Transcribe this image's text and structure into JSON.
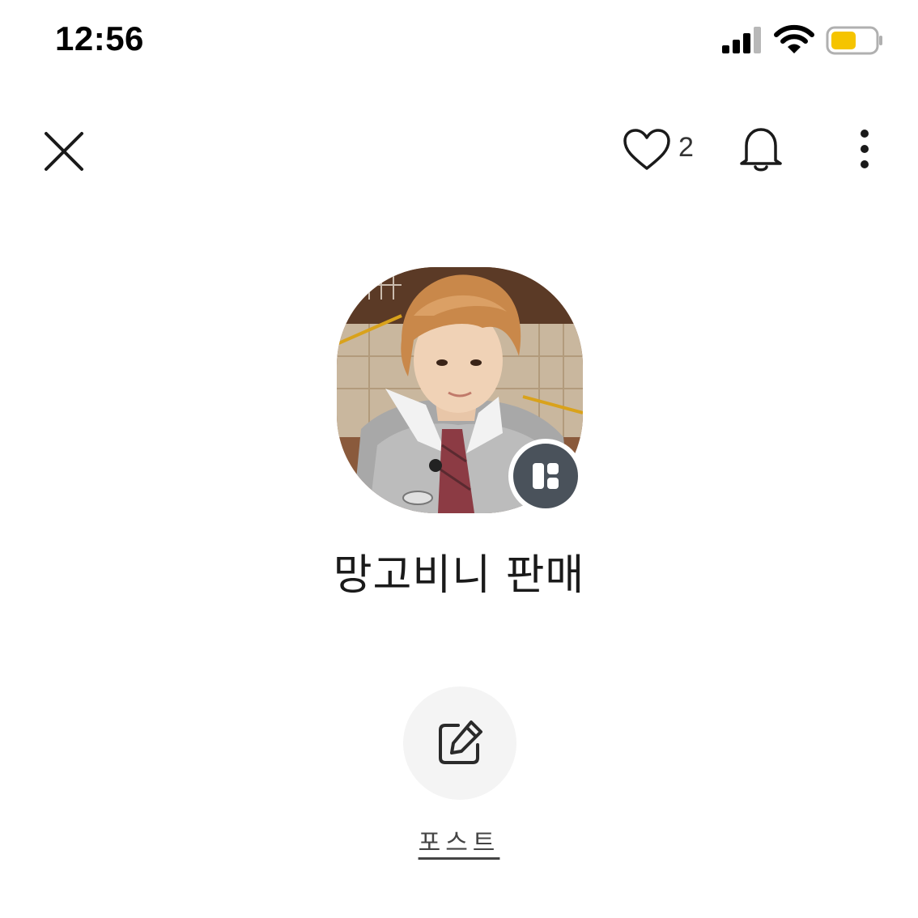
{
  "status_bar": {
    "time": "12:56",
    "icons": [
      "cellular-signal-icon",
      "wifi-icon",
      "battery-icon"
    ],
    "battery_color": "#f5c400"
  },
  "top_nav": {
    "close_icon": "close-icon",
    "like_icon": "heart-icon",
    "like_count": "2",
    "bell_icon": "bell-icon",
    "more_icon": "more-vertical-icon"
  },
  "profile": {
    "name": "망고비니 판매",
    "badge_icon": "profile-page-icon",
    "badge_color": "#4a525b"
  },
  "actions": {
    "post_icon": "edit-icon",
    "post_label": "포스트",
    "post_bg": "#f4f4f4"
  }
}
